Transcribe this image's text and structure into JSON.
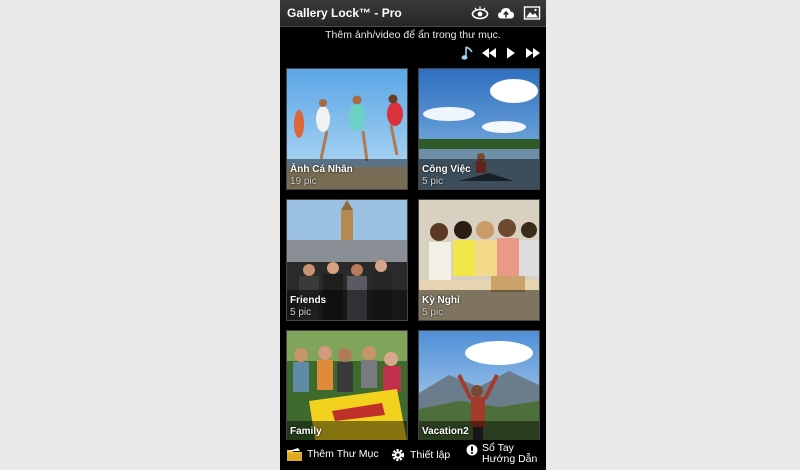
{
  "app": {
    "title": "Gallery Lock™ - Pro"
  },
  "toolbar": {
    "icons": [
      "eye-icon",
      "cloud-upload-icon",
      "image-icon"
    ]
  },
  "hint": "Thêm ảnh/video để ẩn trong thư mục.",
  "media_controls": [
    "music-note-icon",
    "previous-icon",
    "play-icon",
    "next-icon"
  ],
  "albums": [
    {
      "name": "Ảnh Cá Nhân",
      "count": "19 pic"
    },
    {
      "name": "Công Việc",
      "count": "5 pic"
    },
    {
      "name": "Friends",
      "count": "5 pic"
    },
    {
      "name": "Kỳ Nghỉ",
      "count": "5 pic"
    },
    {
      "name": "Family",
      "count": ""
    },
    {
      "name": "Vacation2",
      "count": ""
    }
  ],
  "bottom": {
    "add_folder": "Thêm Thư Mục",
    "settings": "Thiết lập",
    "guide_line1": "Sổ Tay",
    "guide_line2": "Hướng Dẫn"
  },
  "colors": {
    "titlebar": "#2e2e2e",
    "background": "#000000",
    "music_accent": "#9fd3f5"
  }
}
